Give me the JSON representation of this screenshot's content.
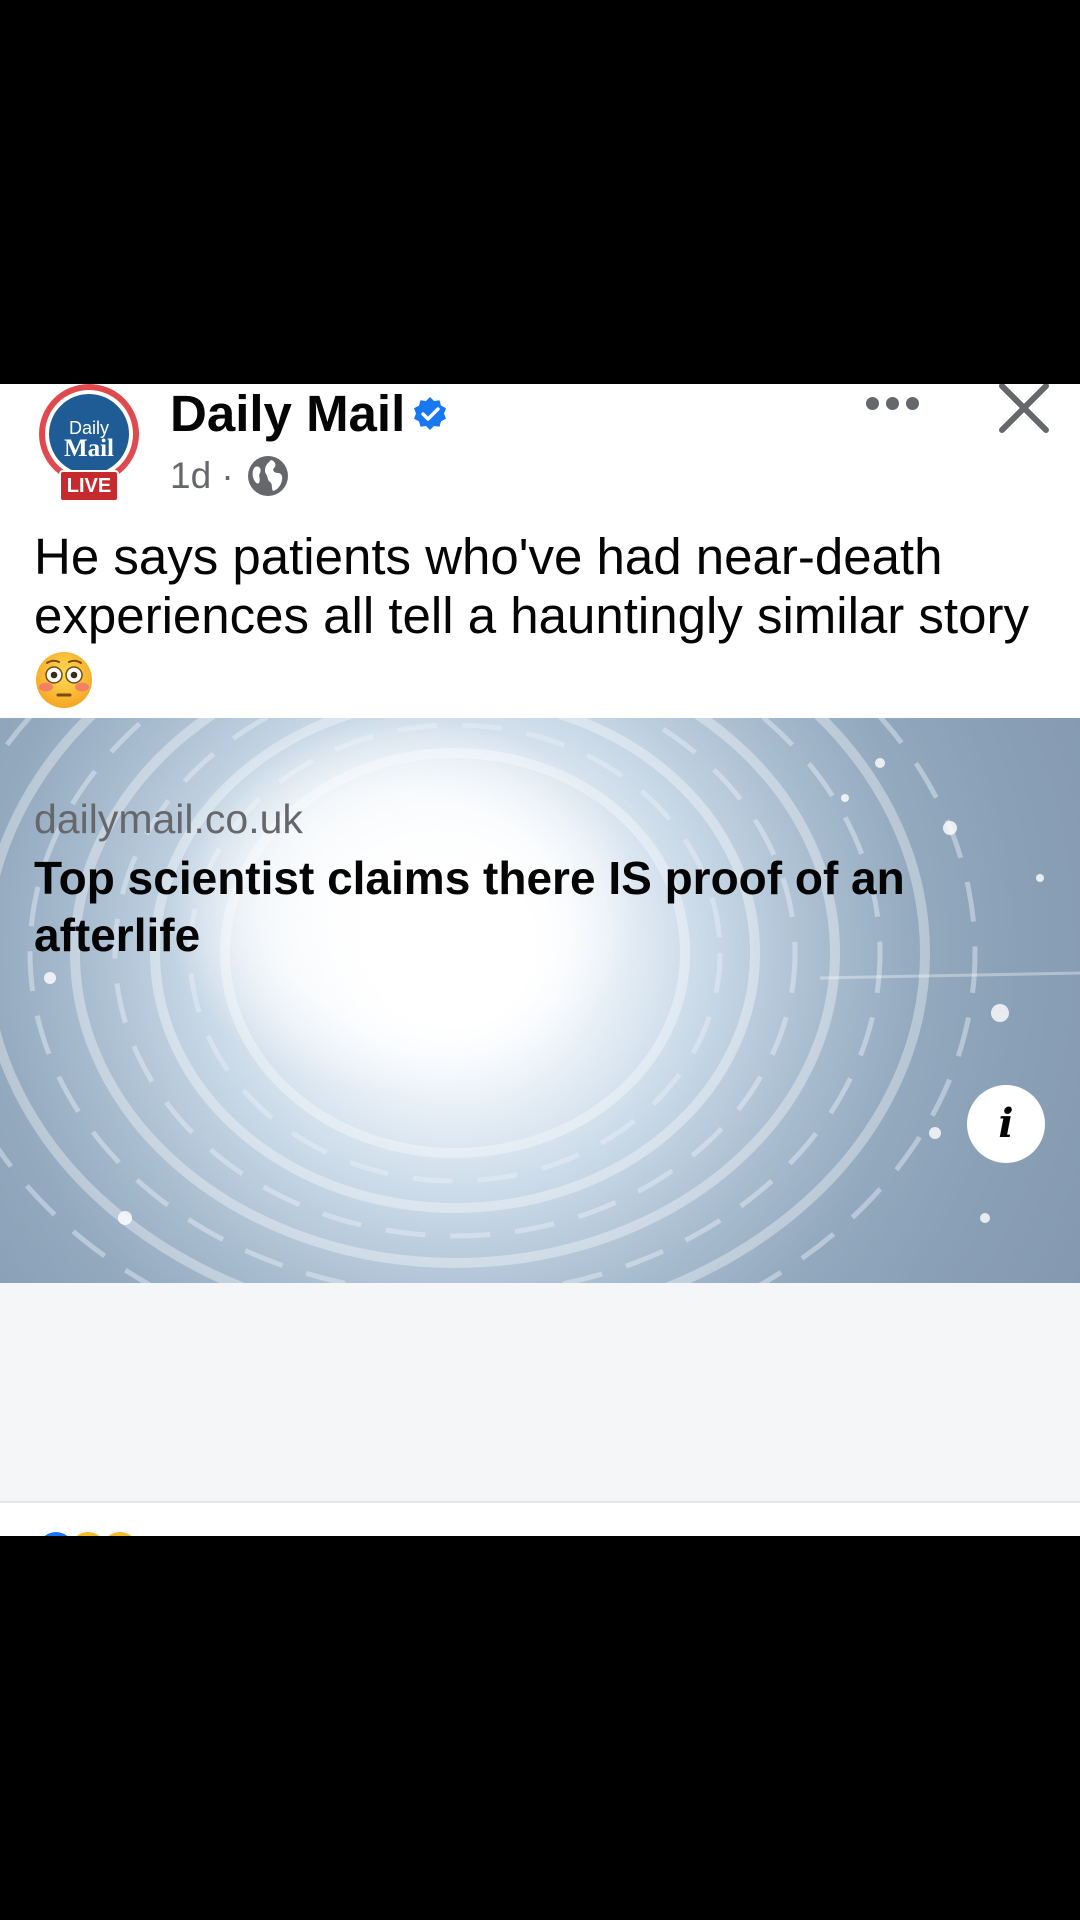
{
  "post": {
    "page_name": "Daily Mail",
    "avatar": {
      "line1": "Daily",
      "line2": "Mail",
      "badge": "LIVE",
      "ring_color": "#e04a4f",
      "inner_color": "#1f5c96",
      "badge_color": "#c72a2e"
    },
    "verified_icon": "verified-badge-icon",
    "verified_color": "#1877f2",
    "timestamp": "1d ·",
    "audience_icon": "globe-icon",
    "more_icon": "more-horizontal-icon",
    "close_icon": "close-icon",
    "caption": "He says patients who've had near-death experiences all tell a hauntingly similar story",
    "caption_emoji": "flushed-face-emoji",
    "link_preview": {
      "image_icon": "light-tunnel-image",
      "info_label": "i",
      "domain": "dailymail.co.uk",
      "title": "Top scientist claims there IS proof of an afterlife"
    }
  }
}
